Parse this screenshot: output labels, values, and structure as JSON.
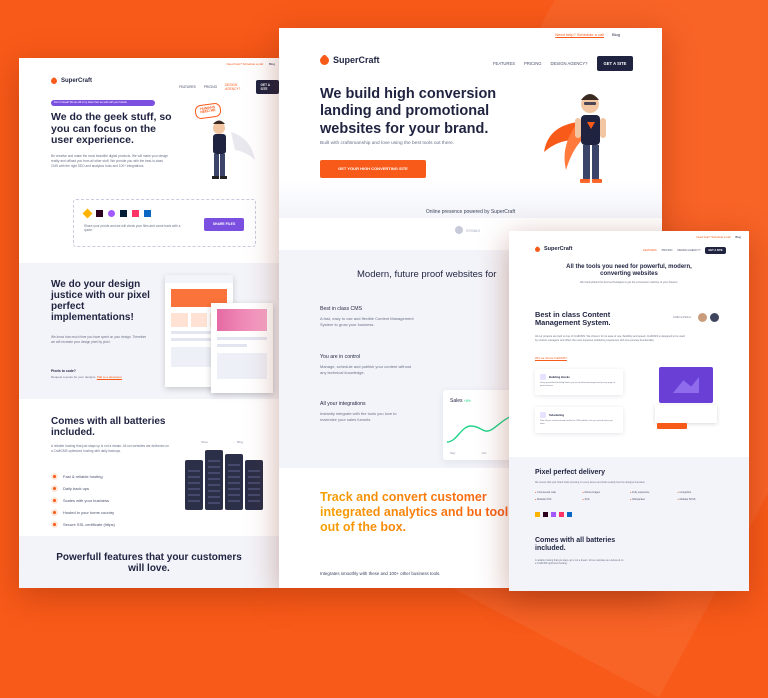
{
  "center": {
    "topbar": {
      "help_link": "Need help? Schedule a call",
      "blog_link": "Blog"
    },
    "brand": "SuperCraft",
    "nav": [
      "FEATURES",
      "PRICING",
      "DESIGN AGENCY?"
    ],
    "nav_cta": "GET A SITE",
    "hero": {
      "title": "We build high conversion landing and promotional websites for your brand.",
      "subtitle": "Built with craftsmanship and love using the best tools out there.",
      "cta": "GET YOUR HIGH CONVERTING SITE"
    },
    "powered_by": "Online presence powered by SuperCraft",
    "partner_logo": "SYMAX",
    "section_title": "Modern, future proof websites for",
    "features": [
      {
        "title": "Best in class CMS",
        "text": "A fast, easy to use and flexible Content Management System to grow your business."
      },
      {
        "title": "You are in control",
        "text": "Manage, schedule and publish your content without any technical knowledge."
      },
      {
        "title": "All your integrations",
        "text": "Instantly integrate with the tools you love to maximize your sales funnels."
      }
    ],
    "chart": {
      "title": "Sales",
      "delta": "+8%",
      "labels": [
        "Sep",
        "Oct",
        "Nov"
      ]
    },
    "track_title": "Track and convert customer integrated analytics and bu tools out of the box.",
    "track_sub": "Integrates smoothly with these and 100+ other business tools."
  },
  "left": {
    "topbar": {
      "help_link": "Need help? Schedule a call",
      "blog_link": "Blog"
    },
    "brand": "SuperCraft",
    "nav": [
      "FEATURES",
      "PRICING",
      "DESIGN AGENCY?"
    ],
    "nav_cta": "GET A SITE",
    "pill": "Don't it break? We are kill to try faster than we work with your brands",
    "hero_title": "We do the geek stuff, so you can focus on the user experience.",
    "hero_text": "Be creative and make the most beautiful digital products. We will make your design reality and offload you from all other stuff. We provide you with the best-in-class CMS with the right SEO and analytics tools and 100+ integrations.",
    "bubble": "HUMANS NEED ME",
    "share_text": "Share your proofs and we will check your files and come back with a quote.",
    "share_btn": "SHARE FILES",
    "pixel_title": "We do your design justice with our pixel perfect implementations!",
    "pixel_text": "We know how much time you have spent on your design. Therefore we will recreate your design pixel by pixel.",
    "pixel_cta_label": "Pixels to code?",
    "pixel_cta_text": "Request a quote for your designs.",
    "pixel_cta_link": "Talk to a developer",
    "batteries_title": "Comes with all batteries included.",
    "batteries_text": "A reliable hosting that just stays up is not a dream. All our websites are delivered on a CraftCMS optimized hosting with daily backups.",
    "checklist": [
      "Fast & reliable hosting",
      "Daily back ups",
      "Scales with your business",
      "Hosted in your home country",
      "Secure SSL certificate (https)"
    ],
    "server_labels": [
      "Shop",
      "Blog"
    ],
    "bottom_title": "Powerfull features that your customers will love."
  },
  "right": {
    "topbar": {
      "help_link": "Need help? Schedule a call",
      "blog_link": "Blog"
    },
    "brand": "SuperCraft",
    "nav": [
      "FEATURES",
      "PRICING",
      "DESIGN AGENCY?"
    ],
    "nav_cta": "GET A SITE",
    "hero_title": "All the tools you need for powerful, modern, converting websites",
    "hero_sub": "We hand-picked the best technologies to get the conversion machine of your dreams.",
    "cms_title": "Best in class Content Management System.",
    "cms_text": "All our projects are built on top of CraftCMS. We chose it for its ease of use, flexibility and speed. CraftCMS is designed to be used by content managers and offers the most luxurious publishing experience with true preview functionality.",
    "cms_link": "Why we choose CraftCMS?",
    "team_badge": "Craftcms Partner",
    "cards": [
      {
        "title": "Building blocks",
        "text": "Using pre-defined building blocks you can build and manage nearly every page of your business."
      },
      {
        "title": "Scheduling",
        "text": "Plan all your content ahead and let the CMS publish it for you exactly when you want."
      }
    ],
    "pixel_title": "Pixel perfect delivery",
    "pixel_sub": "We ensure that your brand looks stunning on every device and looks exactly how the designer intended.",
    "delivery": [
      "Commented code",
      "Retina images",
      "Fully responsive",
      "Incognition",
      "Modular CSS",
      "SVG",
      "Webpacked",
      "Modular SCSS"
    ],
    "batteries_title": "Comes with all batteries included.",
    "batteries_text": "A reliable hosting that just stays up is not a dream. All our websites are delivered on a CraftCMS optimized hosting."
  },
  "colors": {
    "accent": "#f85a19",
    "navy": "#1f2340",
    "purple": "#7b4fe0",
    "green": "#1fd38a"
  }
}
